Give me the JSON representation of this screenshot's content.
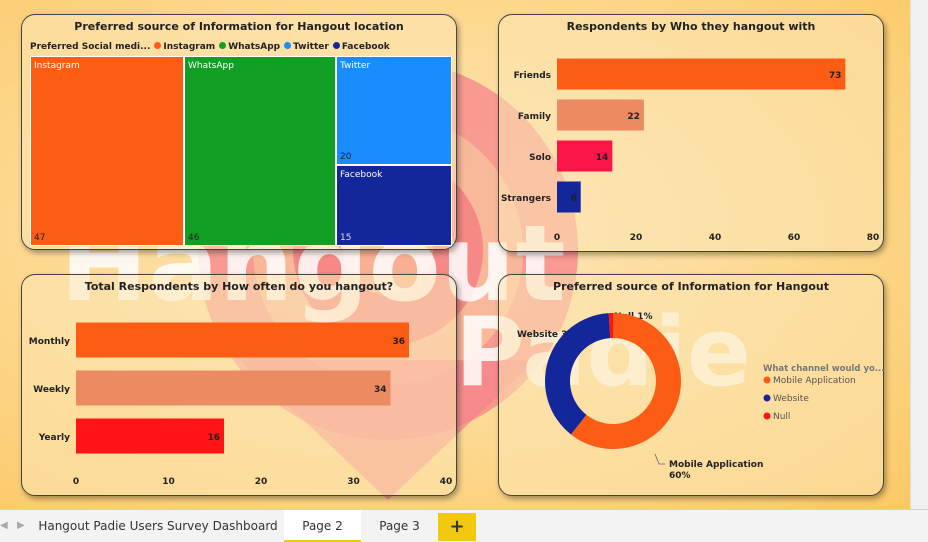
{
  "watermark": {
    "line1": "Hangout",
    "line2": "Padie"
  },
  "treemap_card": {
    "title": "Preferred source of Information for Hangout location",
    "legend_label": "Preferred Social medi...",
    "items": [
      {
        "name": "Instagram",
        "value": 47,
        "color": "#fc5c14"
      },
      {
        "name": "WhatsApp",
        "value": 46,
        "color": "#139e26"
      },
      {
        "name": "Twitter",
        "value": 20,
        "color": "#1a8cfc"
      },
      {
        "name": "Facebook",
        "value": 15,
        "color": "#13269a"
      }
    ]
  },
  "hangout_with_card": {
    "title": "Respondents by Who they hangout with"
  },
  "how_often_card": {
    "title": "Total Respondents by How often do you hangout?"
  },
  "donut_card": {
    "title": "Preferred source of Information for Hangout",
    "legend_title": "What channel would yo...",
    "slice_labels": {
      "null": "Null 1%",
      "website": "Website 38%",
      "mobile_line1": "Mobile Application",
      "mobile_line2": "60%"
    }
  },
  "tabs": {
    "items": [
      {
        "label": "Hangout Padie Users Survey Dashboard",
        "active": false
      },
      {
        "label": "Page 2",
        "active": true
      },
      {
        "label": "Page 3",
        "active": false
      }
    ],
    "add_label": "+",
    "prev_arrow": "◀",
    "next_arrow": "▶"
  },
  "chart_data": [
    {
      "type": "treemap",
      "title": "Preferred source of Information for Hangout location",
      "legend_title": "Preferred Social medi...",
      "categories": [
        "Instagram",
        "WhatsApp",
        "Twitter",
        "Facebook"
      ],
      "values": [
        47,
        46,
        20,
        15
      ],
      "colors": [
        "#fc5c14",
        "#139e26",
        "#1a8cfc",
        "#13269a"
      ]
    },
    {
      "type": "bar",
      "orientation": "horizontal",
      "title": "Respondents by Who they hangout with",
      "categories": [
        "Friends",
        "Family",
        "Solo",
        "Strangers"
      ],
      "values": [
        73,
        22,
        14,
        6
      ],
      "colors": [
        "#fc5c14",
        "#ec8a62",
        "#fb1546",
        "#13269a"
      ],
      "xlim": [
        0,
        80
      ],
      "xticks": [
        0,
        20,
        40,
        60,
        80
      ],
      "grid": false
    },
    {
      "type": "bar",
      "orientation": "horizontal",
      "title": "Total Respondents by How often do you hangout?",
      "categories": [
        "Monthly",
        "Weekly",
        "Yearly"
      ],
      "values": [
        36,
        34,
        16
      ],
      "colors": [
        "#fc5c14",
        "#ec8a62",
        "#fe1414"
      ],
      "xlim": [
        0,
        40
      ],
      "xticks": [
        0,
        10,
        20,
        30,
        40
      ],
      "grid": false
    },
    {
      "type": "pie",
      "donut": true,
      "title": "Preferred source of Information for Hangout",
      "legend_title": "What channel would yo...",
      "categories": [
        "Mobile Application",
        "Website",
        "Null"
      ],
      "values": [
        60,
        38,
        1
      ],
      "colors": [
        "#fc5c14",
        "#13269a",
        "#fe1414"
      ],
      "legend_position": "right"
    }
  ]
}
